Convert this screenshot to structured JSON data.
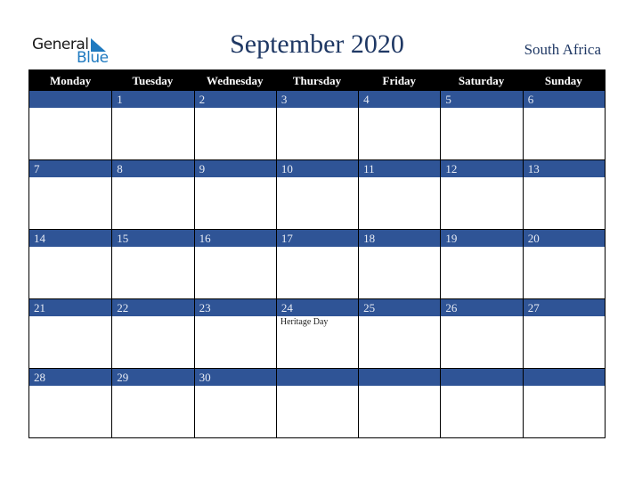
{
  "logo": {
    "line1": "General",
    "line2": "Blue",
    "accent_color": "#1f7ac0",
    "icon": "triangle-logo-icon"
  },
  "title": "September 2020",
  "country": "South Africa",
  "colors": {
    "header_bg": "#000000",
    "date_band": "#2f5496",
    "title": "#1f3864"
  },
  "weekdays": [
    "Monday",
    "Tuesday",
    "Wednesday",
    "Thursday",
    "Friday",
    "Saturday",
    "Sunday"
  ],
  "weeks": [
    [
      {
        "day": ""
      },
      {
        "day": "1"
      },
      {
        "day": "2"
      },
      {
        "day": "3"
      },
      {
        "day": "4"
      },
      {
        "day": "5"
      },
      {
        "day": "6"
      }
    ],
    [
      {
        "day": "7"
      },
      {
        "day": "8"
      },
      {
        "day": "9"
      },
      {
        "day": "10"
      },
      {
        "day": "11"
      },
      {
        "day": "12"
      },
      {
        "day": "13"
      }
    ],
    [
      {
        "day": "14"
      },
      {
        "day": "15"
      },
      {
        "day": "16"
      },
      {
        "day": "17"
      },
      {
        "day": "18"
      },
      {
        "day": "19"
      },
      {
        "day": "20"
      }
    ],
    [
      {
        "day": "21"
      },
      {
        "day": "22"
      },
      {
        "day": "23"
      },
      {
        "day": "24",
        "event": "Heritage Day"
      },
      {
        "day": "25"
      },
      {
        "day": "26"
      },
      {
        "day": "27"
      }
    ],
    [
      {
        "day": "28"
      },
      {
        "day": "29"
      },
      {
        "day": "30"
      },
      {
        "day": ""
      },
      {
        "day": ""
      },
      {
        "day": ""
      },
      {
        "day": ""
      }
    ]
  ]
}
